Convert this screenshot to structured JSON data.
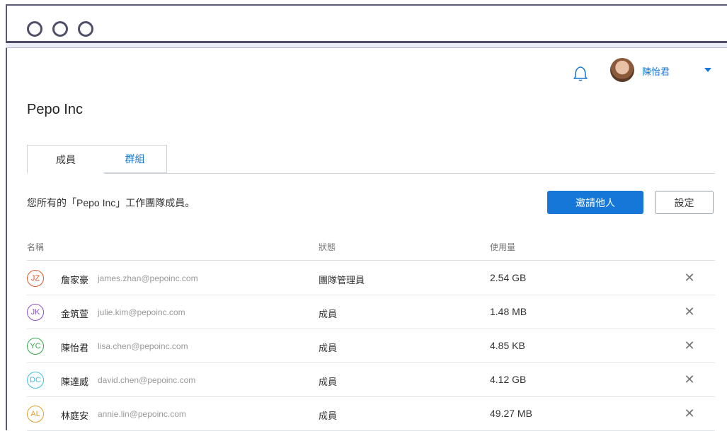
{
  "header": {
    "user_name": "陳怡君"
  },
  "org": {
    "title": "Pepo Inc"
  },
  "tabs": [
    {
      "label": "成員"
    },
    {
      "label": "群組"
    }
  ],
  "main": {
    "description": "您所有的「Pepo Inc」工作團隊成員。",
    "invite_label": "邀請他人",
    "settings_label": "設定"
  },
  "table": {
    "columns": [
      "名稱",
      "狀態",
      "使用量"
    ],
    "rows": [
      {
        "initials": "JZ",
        "color": "#e2562a",
        "name": "詹家豪",
        "email": "james.zhan@pepoinc.com",
        "status": "團隊管理員",
        "usage": "2.54 GB"
      },
      {
        "initials": "JK",
        "color": "#8a4fc9",
        "name": "金筑萱",
        "email": "julie.kim@pepoinc.com",
        "status": "成員",
        "usage": "1.48 MB"
      },
      {
        "initials": "YC",
        "color": "#2fa84a",
        "name": "陳怡君",
        "email": "lisa.chen@pepoinc.com",
        "status": "成員",
        "usage": "4.85 KB"
      },
      {
        "initials": "DC",
        "color": "#3ebfe0",
        "name": "陳達威",
        "email": "david.chen@pepoinc.com",
        "status": "成員",
        "usage": "4.12 GB"
      },
      {
        "initials": "AL",
        "color": "#e0a12a",
        "name": "林庭安",
        "email": "annie.lin@pepoinc.com",
        "status": "成員",
        "usage": "49.27 MB"
      }
    ]
  },
  "icons": {
    "notifications": "bell-icon",
    "user_menu": "caret-down-icon",
    "remove": "close-icon"
  },
  "colors": {
    "accent": "#1677d8"
  }
}
